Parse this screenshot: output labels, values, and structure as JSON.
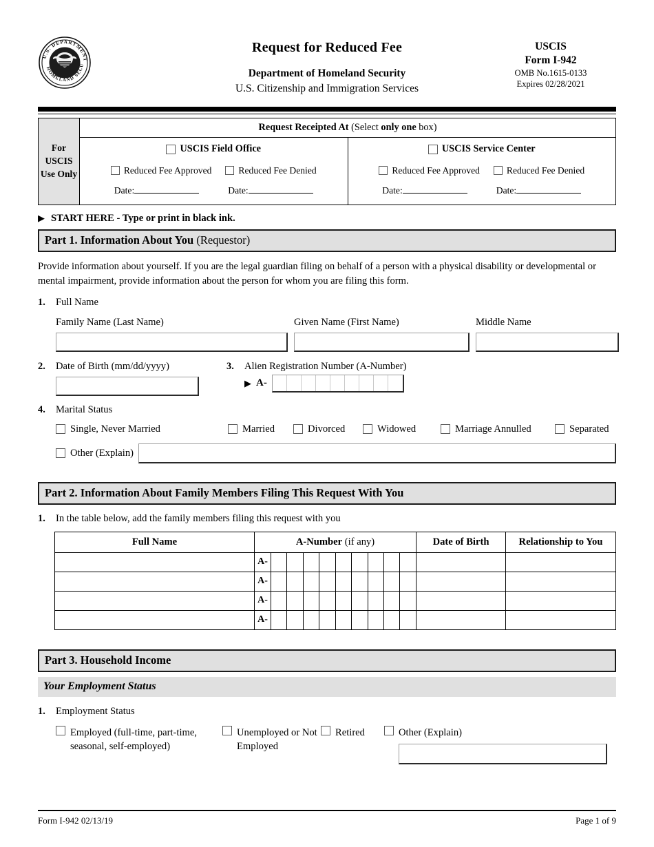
{
  "header": {
    "seal_alt": "Department of Homeland Security seal",
    "title": "Request for Reduced Fee",
    "agency_line1": "Department of Homeland Security",
    "agency_line2": "U.S. Citizenship and Immigration Services",
    "right": {
      "uscis": "USCIS",
      "form": "Form I-942",
      "omb": "OMB No.1615-0133",
      "expires": "Expires 02/28/2021"
    }
  },
  "uscis_use_box": {
    "left_label": "For USCIS Use Only",
    "receipted_at_bold": "Request Receipted At",
    "receipted_at_rest": " (Select ",
    "receipted_only_one": "only one",
    "receipted_box_word": " box)",
    "columns": [
      {
        "title": "USCIS Field Office",
        "approved": "Reduced Fee Approved",
        "denied": "Reduced Fee Denied",
        "date_label_1": "Date:",
        "date_label_2": "Date:"
      },
      {
        "title": "USCIS Service Center",
        "approved": "Reduced Fee Approved",
        "denied": "Reduced Fee Denied",
        "date_label_1": "Date:",
        "date_label_2": "Date:"
      }
    ]
  },
  "start_here": "START HERE - Type or print in black ink.",
  "part1": {
    "heading_bold": "Part 1.  Information About You",
    "heading_light": " (Requestor)",
    "intro": "Provide information about yourself.  If you are the legal guardian filing on behalf of a person with a physical disability or developmental or mental impairment, provide information about the person for whom you are filing this form.",
    "q1": {
      "num": "1.",
      "label": "Full Name",
      "family_name_label": "Family Name (Last Name)",
      "given_name_label": "Given Name (First Name)",
      "middle_name_label": "Middle Name",
      "family_name_value": "",
      "given_name_value": "",
      "middle_name_value": ""
    },
    "q2": {
      "num": "2.",
      "label": "Date of Birth (mm/dd/yyyy)",
      "value": ""
    },
    "q3": {
      "num": "3.",
      "label": "Alien Registration Number (A-Number)",
      "prefix": "A-",
      "cells": 9
    },
    "q4": {
      "num": "4.",
      "label": "Marital Status",
      "options": [
        "Single, Never Married",
        "Married",
        "Divorced",
        "Widowed",
        "Marriage Annulled",
        "Separated"
      ],
      "other_label": "Other (Explain)",
      "other_value": ""
    }
  },
  "part2": {
    "heading_bold": "Part 2.  Information About Family Members Filing This Request With You",
    "q1": {
      "num": "1.",
      "label": "In the table below, add the family members filing this request with you"
    },
    "table": {
      "columns": [
        {
          "bold": "Full Name",
          "light": ""
        },
        {
          "bold": "A-Number",
          "light": " (if any)"
        },
        {
          "bold": "Date of Birth",
          "light": ""
        },
        {
          "bold": "Relationship to You",
          "light": ""
        }
      ],
      "a_prefix": "A-",
      "a_cells": 9,
      "rows": [
        {
          "full_name": "",
          "a_number": "",
          "date_of_birth": "",
          "relationship": ""
        },
        {
          "full_name": "",
          "a_number": "",
          "date_of_birth": "",
          "relationship": ""
        },
        {
          "full_name": "",
          "a_number": "",
          "date_of_birth": "",
          "relationship": ""
        },
        {
          "full_name": "",
          "a_number": "",
          "date_of_birth": "",
          "relationship": ""
        }
      ]
    }
  },
  "part3": {
    "heading_bold": "Part 3.  Household Income",
    "subheading": "Your Employment Status",
    "q1": {
      "num": "1.",
      "label": "Employment Status",
      "options": [
        "Employed (full-time, part-time, seasonal, self-employed)",
        "Unemployed or Not Employed",
        "Retired",
        "Other (Explain)"
      ],
      "other_value": ""
    }
  },
  "footer": {
    "left": "Form I-942   02/13/19",
    "right": "Page 1 of 9"
  },
  "colors": {
    "band_gray": "#e0e0e0",
    "rule_black": "#000000",
    "box_border": "#2a2a2a"
  }
}
